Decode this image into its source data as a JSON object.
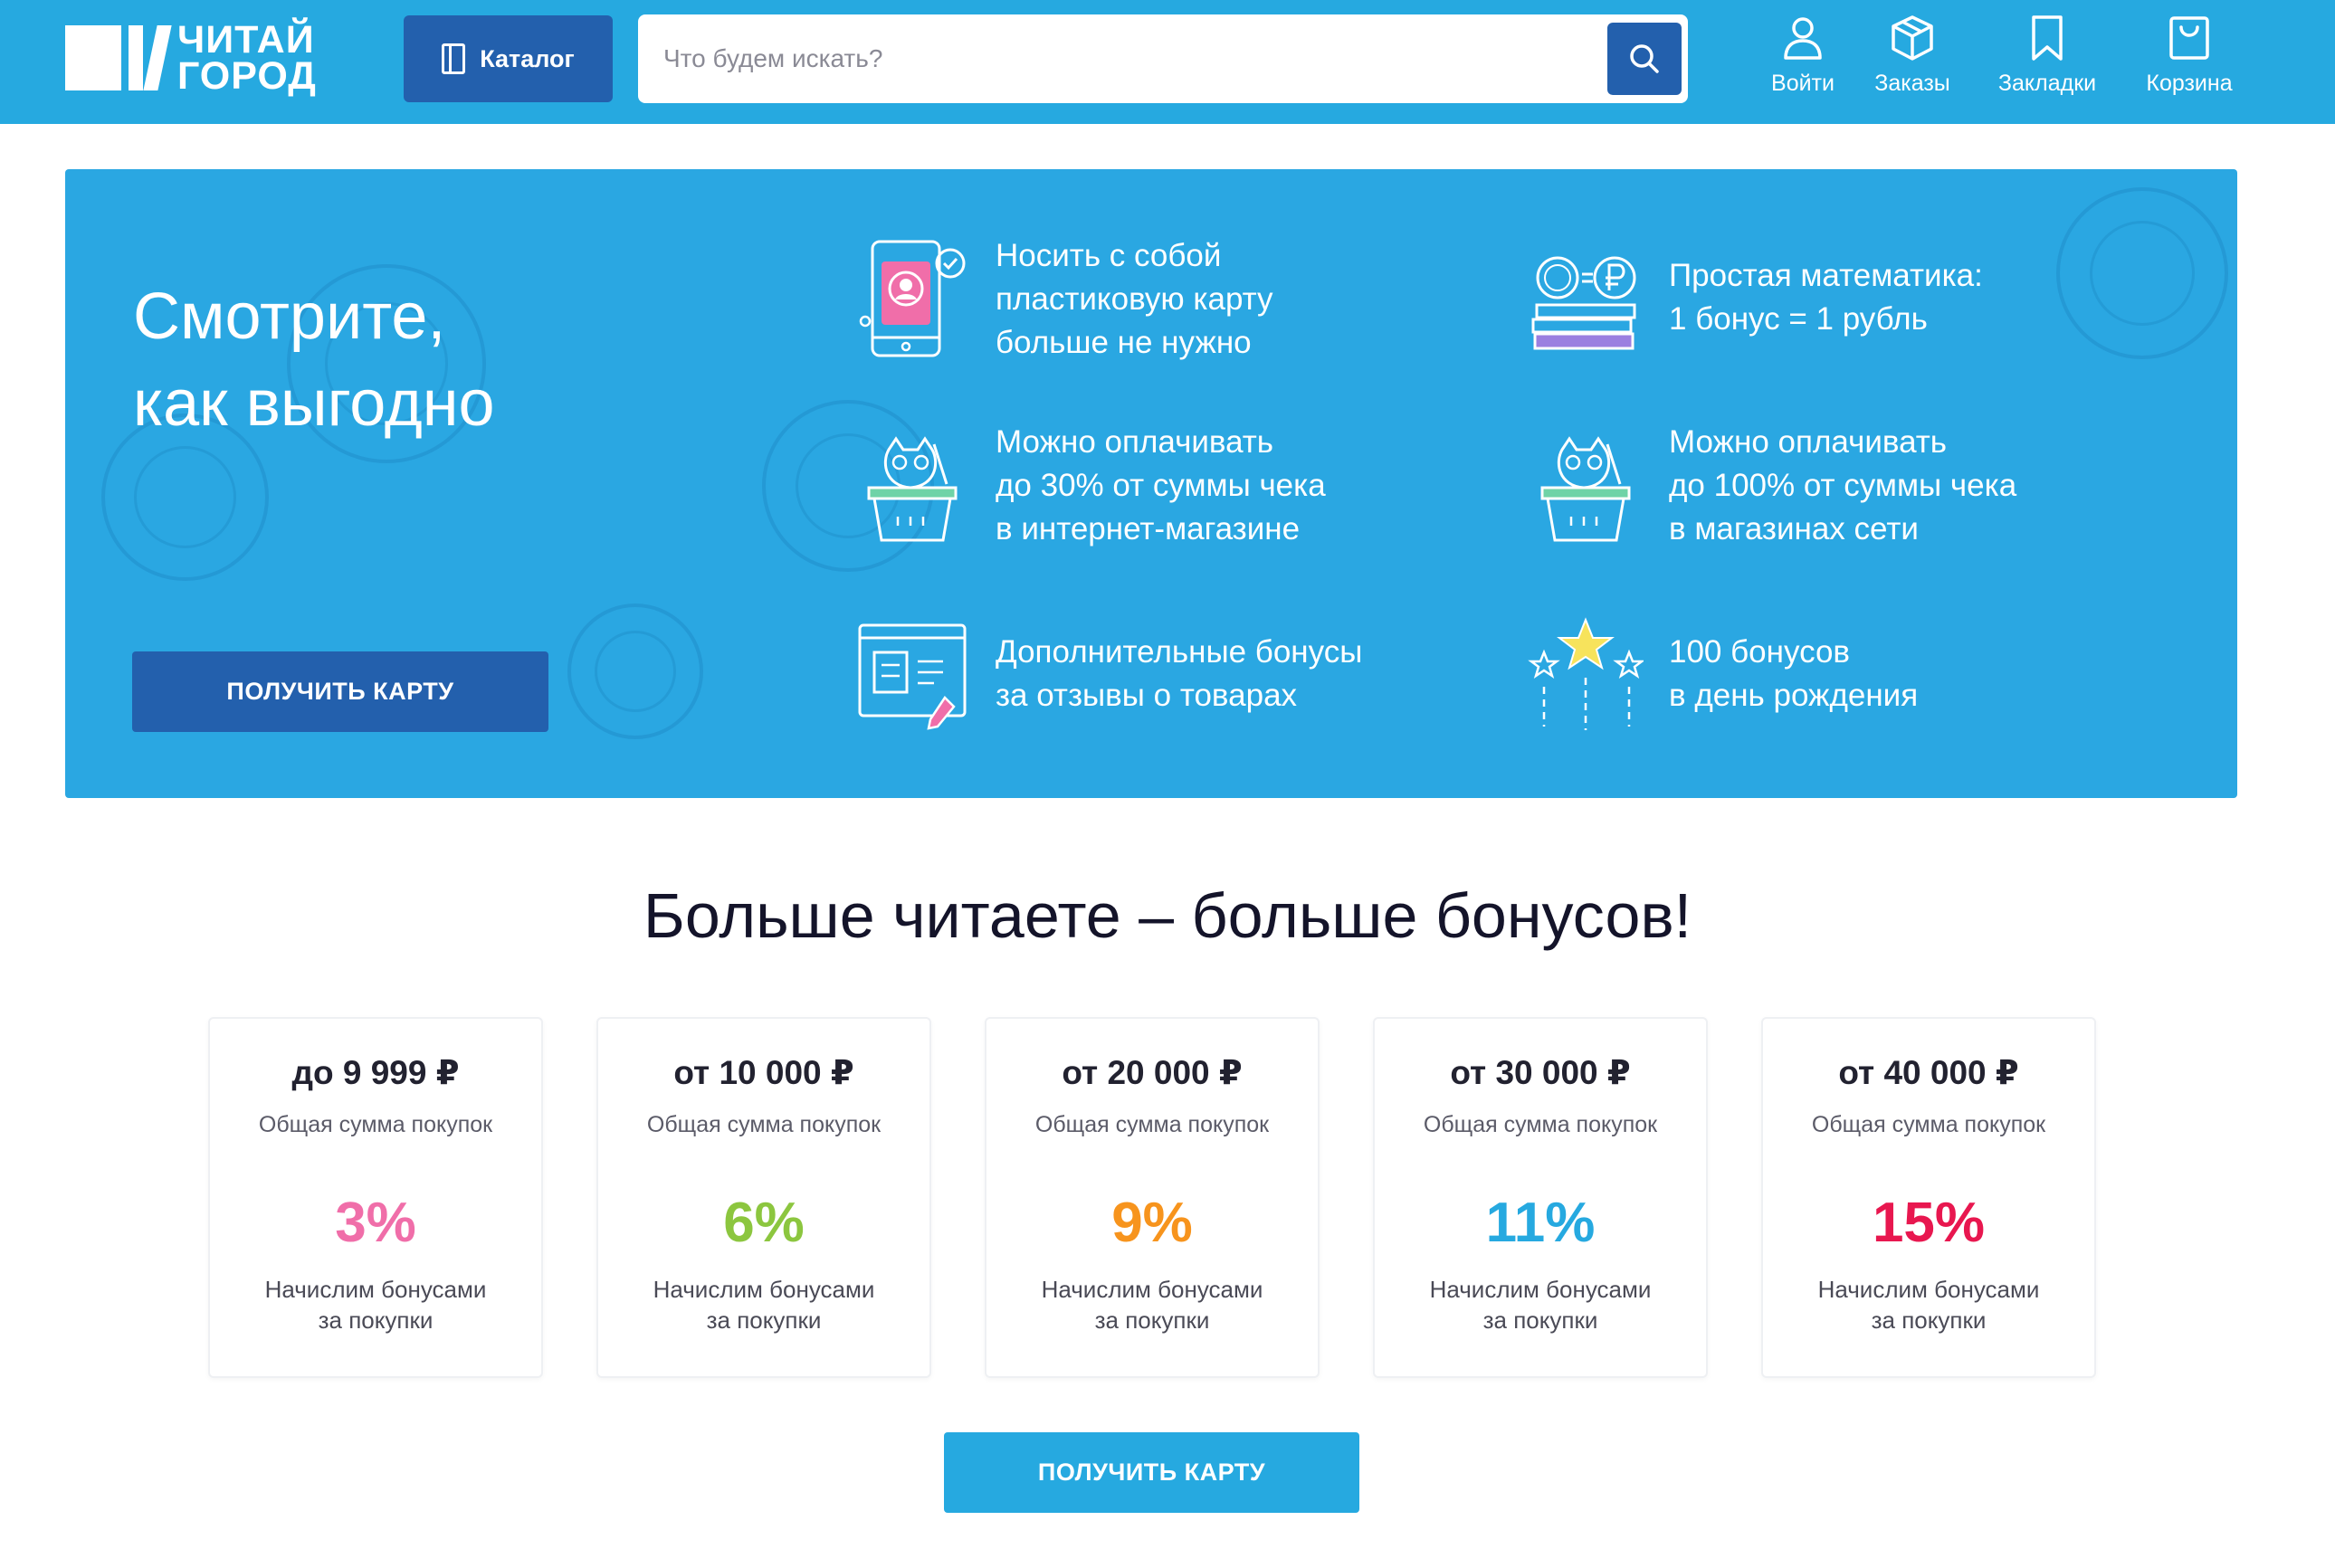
{
  "header": {
    "logo": {
      "line1": "ЧИТАЙ",
      "line2": "ГОРОД"
    },
    "catalog_label": "Каталог",
    "search": {
      "placeholder": "Что будем искать?",
      "value": ""
    },
    "nav": [
      {
        "label": "Войти",
        "icon": "user-icon"
      },
      {
        "label": "Заказы",
        "icon": "box-icon"
      },
      {
        "label": "Закладки",
        "icon": "bookmark-icon"
      },
      {
        "label": "Корзина",
        "icon": "cart-icon"
      }
    ]
  },
  "promo": {
    "title_line1": "Смотрите,",
    "title_line2": "как выгодно",
    "button_label": "ПОЛУЧИТЬ КАРТУ",
    "benefits": [
      {
        "icon": "phone-card-icon",
        "lines": [
          "Носить с собой",
          "пластиковую карту",
          "больше не нужно"
        ]
      },
      {
        "icon": "coin-ruble-books-icon",
        "lines": [
          "Простая математика:",
          "1 бонус = 1 рубль"
        ]
      },
      {
        "icon": "owl-basket-icon",
        "lines": [
          "Можно оплачивать",
          "до 30% от суммы чека",
          "в интернет-магазине"
        ]
      },
      {
        "icon": "owl-basket-icon",
        "lines": [
          "Можно оплачивать",
          "до 100% от суммы чека",
          "в магазинах сети"
        ]
      },
      {
        "icon": "review-form-icon",
        "lines": [
          "Дополнительные бонусы",
          "за отзывы о товарах"
        ]
      },
      {
        "icon": "stars-icon",
        "lines": [
          "100 бонусов",
          "в день рождения"
        ]
      }
    ]
  },
  "bonus_section": {
    "title": "Больше читаете – больше бонусов!",
    "tiers": [
      {
        "amount": "до 9 999 ₽",
        "subtitle": "Общая сумма покупок",
        "percent": "3%",
        "color": "#f06ea9",
        "desc1": "Начислим бонусами",
        "desc2": "за покупки"
      },
      {
        "amount": "от 10 000 ₽",
        "subtitle": "Общая сумма покупок",
        "percent": "6%",
        "color": "#8cc63f",
        "desc1": "Начислим бонусами",
        "desc2": "за покупки"
      },
      {
        "amount": "от 20 000 ₽",
        "subtitle": "Общая сумма покупок",
        "percent": "9%",
        "color": "#f7941d",
        "desc1": "Начислим бонусами",
        "desc2": "за покупки"
      },
      {
        "amount": "от 30 000 ₽",
        "subtitle": "Общая сумма покупок",
        "percent": "11%",
        "color": "#26a9e0",
        "desc1": "Начислим бонусами",
        "desc2": "за покупки"
      },
      {
        "amount": "от 40 000 ₽",
        "subtitle": "Общая сумма покупок",
        "percent": "15%",
        "color": "#e8174f",
        "desc1": "Начислим бонусами",
        "desc2": "за покупки"
      }
    ],
    "button_label": "ПОЛУЧИТЬ КАРТУ"
  },
  "colors": {
    "header_bg": "#26a9e0",
    "dark_blue": "#2360ad",
    "promo_bg": "#2aa7e2"
  }
}
